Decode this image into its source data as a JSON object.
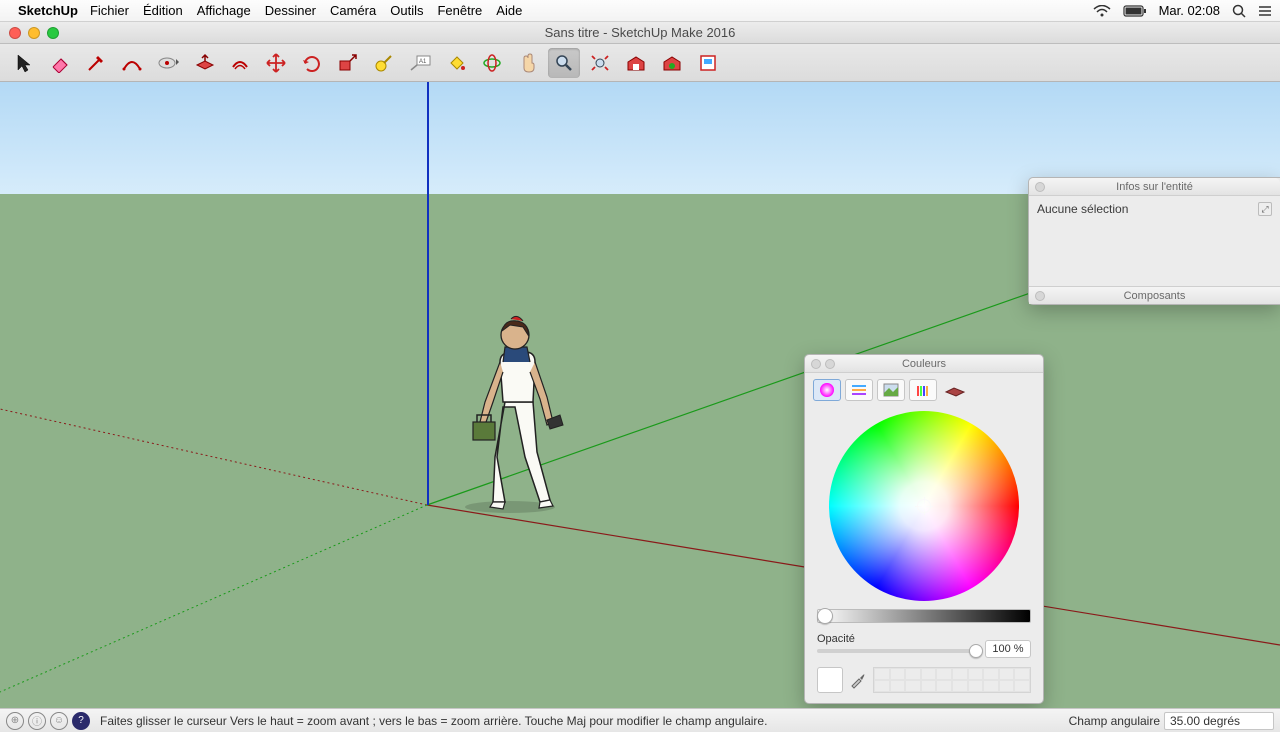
{
  "menubar": {
    "app": "SketchUp",
    "items": [
      "Fichier",
      "Édition",
      "Affichage",
      "Dessiner",
      "Caméra",
      "Outils",
      "Fenêtre",
      "Aide"
    ],
    "clock": "Mar. 02:08"
  },
  "window": {
    "title": "Sans titre - SketchUp Make 2016"
  },
  "toolbar_icons": [
    "select-arrow",
    "eraser",
    "pencil",
    "arc",
    "circle",
    "push-pull",
    "offset",
    "move",
    "rotate",
    "scale",
    "tape-measure",
    "text-label",
    "paint-bucket",
    "orbit",
    "pan-hand",
    "zoom",
    "zoom-extents",
    "previous-view",
    "next-view",
    "add-location"
  ],
  "entity_panel": {
    "title": "Infos sur l'entité",
    "body": "Aucune sélection"
  },
  "components_panel": {
    "title": "Composants"
  },
  "color_panel": {
    "title": "Couleurs",
    "opacity_label": "Opacité",
    "opacity_value": "100 %",
    "tabs": [
      "color-wheel",
      "sliders",
      "image-palette",
      "crayons",
      "materials"
    ]
  },
  "statusbar": {
    "hint": "Faites glisser le curseur  Vers le haut = zoom avant ; vers le bas = zoom arrière. Touche Maj pour modifier le champ angulaire.",
    "field_label": "Champ angulaire",
    "field_value": "35.00 degrés"
  }
}
